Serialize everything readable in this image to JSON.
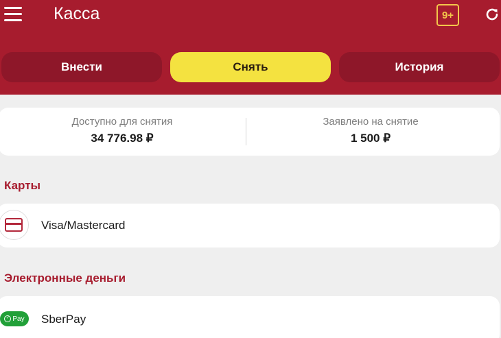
{
  "header": {
    "title": "Касса",
    "age_badge": "9+",
    "icons": [
      "menu-icon",
      "age-restriction-icon",
      "refresh-icon"
    ],
    "background": "#a71c2e"
  },
  "tabs": [
    {
      "label": "Внести",
      "active": false
    },
    {
      "label": "Снять",
      "active": true
    },
    {
      "label": "История",
      "active": false
    }
  ],
  "balance": {
    "available_label": "Доступно для снятия",
    "available_value": "34 776.98 ₽",
    "requested_label": "Заявлено на снятие",
    "requested_value": "1 500 ₽"
  },
  "sections": [
    {
      "title": "Карты",
      "methods": [
        {
          "label": "Visa/Mastercard",
          "icon": "bank-card-icon"
        }
      ]
    },
    {
      "title": "Электронные деньги",
      "methods": [
        {
          "label": "SberPay",
          "icon": "sberpay-icon",
          "badge": "Pay"
        }
      ]
    }
  ],
  "colors": {
    "accent": "#a71c2e",
    "active_tab": "#f4e240",
    "background": "#efefef"
  }
}
